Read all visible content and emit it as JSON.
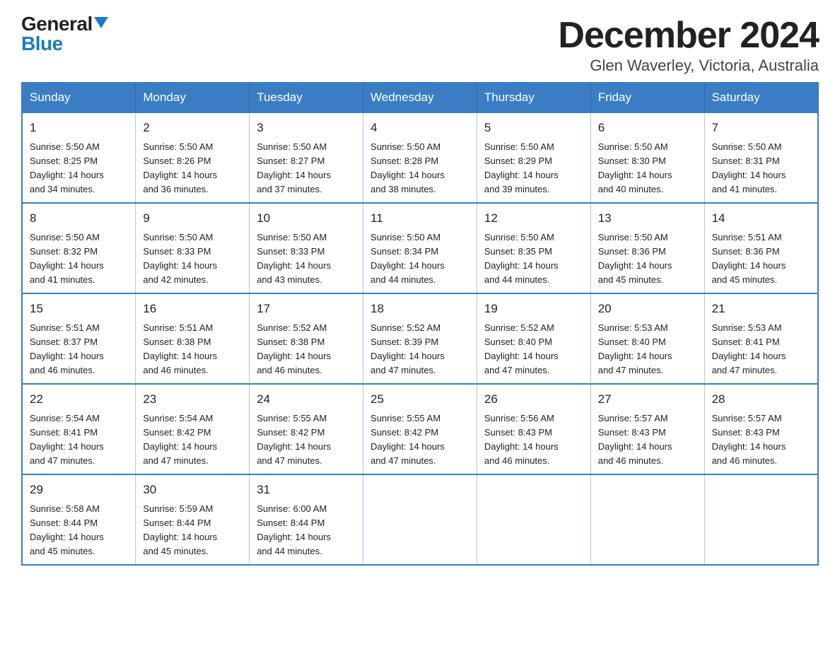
{
  "logo": {
    "general": "General",
    "blue": "Blue"
  },
  "header": {
    "title": "December 2024",
    "subtitle": "Glen Waverley, Victoria, Australia"
  },
  "weekdays": [
    "Sunday",
    "Monday",
    "Tuesday",
    "Wednesday",
    "Thursday",
    "Friday",
    "Saturday"
  ],
  "weeks": [
    [
      {
        "day": "1",
        "sunrise": "5:50 AM",
        "sunset": "8:25 PM",
        "daylight": "14 hours and 34 minutes."
      },
      {
        "day": "2",
        "sunrise": "5:50 AM",
        "sunset": "8:26 PM",
        "daylight": "14 hours and 36 minutes."
      },
      {
        "day": "3",
        "sunrise": "5:50 AM",
        "sunset": "8:27 PM",
        "daylight": "14 hours and 37 minutes."
      },
      {
        "day": "4",
        "sunrise": "5:50 AM",
        "sunset": "8:28 PM",
        "daylight": "14 hours and 38 minutes."
      },
      {
        "day": "5",
        "sunrise": "5:50 AM",
        "sunset": "8:29 PM",
        "daylight": "14 hours and 39 minutes."
      },
      {
        "day": "6",
        "sunrise": "5:50 AM",
        "sunset": "8:30 PM",
        "daylight": "14 hours and 40 minutes."
      },
      {
        "day": "7",
        "sunrise": "5:50 AM",
        "sunset": "8:31 PM",
        "daylight": "14 hours and 41 minutes."
      }
    ],
    [
      {
        "day": "8",
        "sunrise": "5:50 AM",
        "sunset": "8:32 PM",
        "daylight": "14 hours and 41 minutes."
      },
      {
        "day": "9",
        "sunrise": "5:50 AM",
        "sunset": "8:33 PM",
        "daylight": "14 hours and 42 minutes."
      },
      {
        "day": "10",
        "sunrise": "5:50 AM",
        "sunset": "8:33 PM",
        "daylight": "14 hours and 43 minutes."
      },
      {
        "day": "11",
        "sunrise": "5:50 AM",
        "sunset": "8:34 PM",
        "daylight": "14 hours and 44 minutes."
      },
      {
        "day": "12",
        "sunrise": "5:50 AM",
        "sunset": "8:35 PM",
        "daylight": "14 hours and 44 minutes."
      },
      {
        "day": "13",
        "sunrise": "5:50 AM",
        "sunset": "8:36 PM",
        "daylight": "14 hours and 45 minutes."
      },
      {
        "day": "14",
        "sunrise": "5:51 AM",
        "sunset": "8:36 PM",
        "daylight": "14 hours and 45 minutes."
      }
    ],
    [
      {
        "day": "15",
        "sunrise": "5:51 AM",
        "sunset": "8:37 PM",
        "daylight": "14 hours and 46 minutes."
      },
      {
        "day": "16",
        "sunrise": "5:51 AM",
        "sunset": "8:38 PM",
        "daylight": "14 hours and 46 minutes."
      },
      {
        "day": "17",
        "sunrise": "5:52 AM",
        "sunset": "8:38 PM",
        "daylight": "14 hours and 46 minutes."
      },
      {
        "day": "18",
        "sunrise": "5:52 AM",
        "sunset": "8:39 PM",
        "daylight": "14 hours and 47 minutes."
      },
      {
        "day": "19",
        "sunrise": "5:52 AM",
        "sunset": "8:40 PM",
        "daylight": "14 hours and 47 minutes."
      },
      {
        "day": "20",
        "sunrise": "5:53 AM",
        "sunset": "8:40 PM",
        "daylight": "14 hours and 47 minutes."
      },
      {
        "day": "21",
        "sunrise": "5:53 AM",
        "sunset": "8:41 PM",
        "daylight": "14 hours and 47 minutes."
      }
    ],
    [
      {
        "day": "22",
        "sunrise": "5:54 AM",
        "sunset": "8:41 PM",
        "daylight": "14 hours and 47 minutes."
      },
      {
        "day": "23",
        "sunrise": "5:54 AM",
        "sunset": "8:42 PM",
        "daylight": "14 hours and 47 minutes."
      },
      {
        "day": "24",
        "sunrise": "5:55 AM",
        "sunset": "8:42 PM",
        "daylight": "14 hours and 47 minutes."
      },
      {
        "day": "25",
        "sunrise": "5:55 AM",
        "sunset": "8:42 PM",
        "daylight": "14 hours and 47 minutes."
      },
      {
        "day": "26",
        "sunrise": "5:56 AM",
        "sunset": "8:43 PM",
        "daylight": "14 hours and 46 minutes."
      },
      {
        "day": "27",
        "sunrise": "5:57 AM",
        "sunset": "8:43 PM",
        "daylight": "14 hours and 46 minutes."
      },
      {
        "day": "28",
        "sunrise": "5:57 AM",
        "sunset": "8:43 PM",
        "daylight": "14 hours and 46 minutes."
      }
    ],
    [
      {
        "day": "29",
        "sunrise": "5:58 AM",
        "sunset": "8:44 PM",
        "daylight": "14 hours and 45 minutes."
      },
      {
        "day": "30",
        "sunrise": "5:59 AM",
        "sunset": "8:44 PM",
        "daylight": "14 hours and 45 minutes."
      },
      {
        "day": "31",
        "sunrise": "6:00 AM",
        "sunset": "8:44 PM",
        "daylight": "14 hours and 44 minutes."
      },
      null,
      null,
      null,
      null
    ]
  ],
  "labels": {
    "sunrise": "Sunrise:",
    "sunset": "Sunset:",
    "daylight": "Daylight:"
  }
}
